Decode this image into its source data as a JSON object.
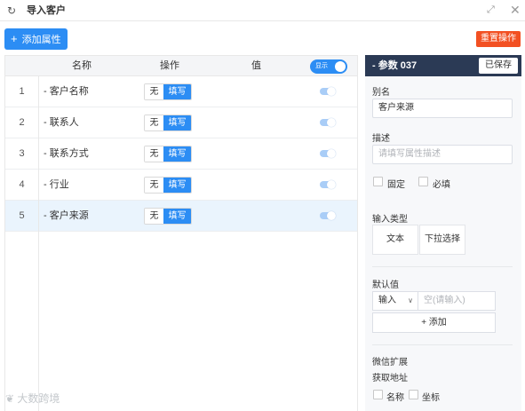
{
  "window": {
    "title": "导入客户"
  },
  "toolbar": {
    "add_label": "添加属性",
    "reset_label": "重置操作"
  },
  "table": {
    "headers": {
      "name": "名称",
      "op": "操作",
      "val": "值"
    },
    "display_toggle": {
      "label": "显示",
      "on": true
    },
    "rows": [
      {
        "idx": "1",
        "name": "- 客户名称",
        "opt_a": "无",
        "opt_b": "填写"
      },
      {
        "idx": "2",
        "name": "- 联系人",
        "opt_a": "无",
        "opt_b": "填写"
      },
      {
        "idx": "3",
        "name": "- 联系方式",
        "opt_a": "无",
        "opt_b": "填写"
      },
      {
        "idx": "4",
        "name": "- 行业",
        "opt_a": "无",
        "opt_b": "填写"
      },
      {
        "idx": "5",
        "name": "- 客户来源",
        "opt_a": "无",
        "opt_b": "填写"
      }
    ],
    "selected_row": 5
  },
  "panel": {
    "title": "- 参数 037",
    "saved_label": "已保存",
    "alias_label": "别名",
    "alias_value": "客户来源",
    "desc_label": "描述",
    "desc_placeholder": "请填写属性描述",
    "fixed_label": "固定",
    "required_label": "必填",
    "input_type_label": "输入类型",
    "type_text": "文本",
    "type_dropdown": "下拉选择",
    "default_label": "默认值",
    "default_mode": "输入",
    "default_placeholder": "空(请输入)",
    "add_label": "+  添加",
    "wechat_label": "微信扩展",
    "fetch_label": "获取地址",
    "opt_name": "名称",
    "opt_coord": "坐标"
  },
  "watermark": "大数跨境",
  "colors": {
    "primary": "#2c8df4",
    "danger": "#f25022",
    "panel_header": "#2b3a55",
    "selected_row": "#eaf4fd"
  }
}
